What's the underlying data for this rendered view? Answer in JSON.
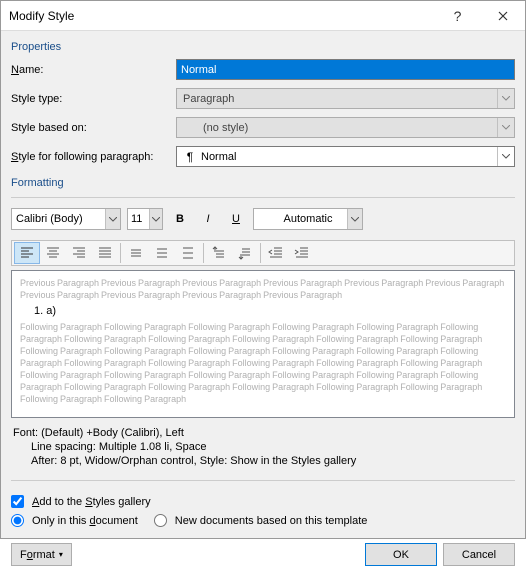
{
  "titlebar": {
    "title": "Modify Style"
  },
  "sections": {
    "properties": "Properties",
    "formatting": "Formatting"
  },
  "labels": {
    "name": "Name:",
    "style_type": "Style type:",
    "style_based": "Style based on:",
    "style_following": "Style for following paragraph:"
  },
  "fields": {
    "name": "Normal",
    "style_type": "Paragraph",
    "style_based": "(no style)",
    "style_following": "Normal"
  },
  "format_bar": {
    "font": "Calibri (Body)",
    "size": "11",
    "color": "Automatic"
  },
  "preview": {
    "prev_para": "Previous Paragraph Previous Paragraph Previous Paragraph Previous Paragraph Previous Paragraph Previous Paragraph Previous Paragraph Previous Paragraph Previous Paragraph Previous Paragraph",
    "sample": "1.          a)",
    "next_para": "Following Paragraph Following Paragraph Following Paragraph Following Paragraph Following Paragraph Following Paragraph Following Paragraph Following Paragraph Following Paragraph Following Paragraph Following Paragraph Following Paragraph Following Paragraph Following Paragraph Following Paragraph Following Paragraph Following Paragraph Following Paragraph Following Paragraph Following Paragraph Following Paragraph Following Paragraph Following Paragraph Following Paragraph Following Paragraph Following Paragraph Following Paragraph Following Paragraph Following Paragraph Following Paragraph Following Paragraph Following Paragraph Following Paragraph Following Paragraph Following Paragraph"
  },
  "description": {
    "line1": "Font: (Default) +Body (Calibri), Left",
    "line2": "Line spacing:  Multiple 1.08 li, Space",
    "line3": "After:  8 pt, Widow/Orphan control, Style: Show in the Styles gallery"
  },
  "options": {
    "add_gallery": "Add to the Styles gallery",
    "only_doc": "Only in this document",
    "new_docs": "New documents based on this template"
  },
  "buttons": {
    "format": "Format",
    "ok": "OK",
    "cancel": "Cancel"
  }
}
